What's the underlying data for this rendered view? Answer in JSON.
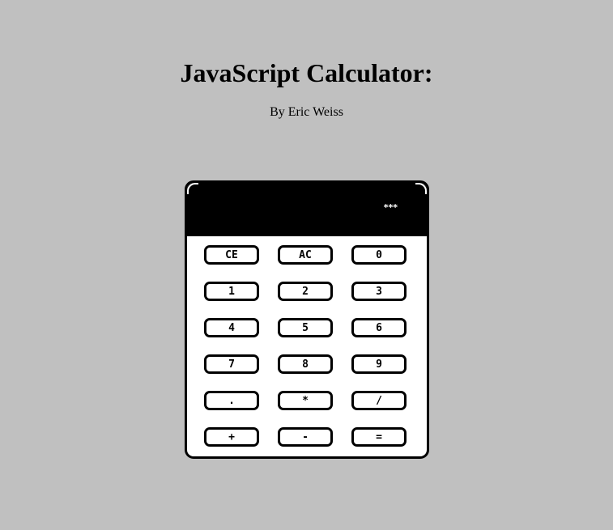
{
  "page": {
    "title": "JavaScript Calculator:",
    "byline": "By Eric Weiss"
  },
  "calculator": {
    "display": "***",
    "keys": [
      {
        "label": "CE",
        "name": "key-clear-entry"
      },
      {
        "label": "AC",
        "name": "key-all-clear"
      },
      {
        "label": "0",
        "name": "key-0"
      },
      {
        "label": "1",
        "name": "key-1"
      },
      {
        "label": "2",
        "name": "key-2"
      },
      {
        "label": "3",
        "name": "key-3"
      },
      {
        "label": "4",
        "name": "key-4"
      },
      {
        "label": "5",
        "name": "key-5"
      },
      {
        "label": "6",
        "name": "key-6"
      },
      {
        "label": "7",
        "name": "key-7"
      },
      {
        "label": "8",
        "name": "key-8"
      },
      {
        "label": "9",
        "name": "key-9"
      },
      {
        "label": ".",
        "name": "key-decimal"
      },
      {
        "label": "*",
        "name": "key-multiply"
      },
      {
        "label": "/",
        "name": "key-divide"
      },
      {
        "label": "+",
        "name": "key-add"
      },
      {
        "label": "-",
        "name": "key-subtract"
      },
      {
        "label": "=",
        "name": "key-equals"
      }
    ]
  },
  "colors": {
    "background": "#c0c0c0",
    "display_background": "#000000",
    "key_border": "#000000",
    "key_background": "#ffffff"
  }
}
